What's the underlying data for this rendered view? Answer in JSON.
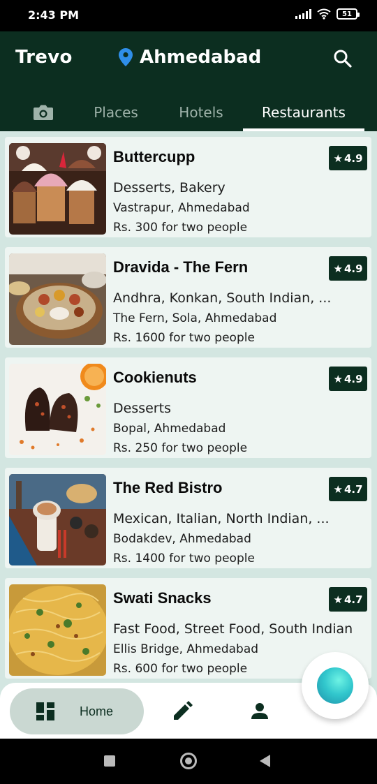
{
  "status_bar": {
    "time": "2:43 PM",
    "battery": "51"
  },
  "header": {
    "brand": "Trevo",
    "location": "Ahmedabad",
    "location_icon": "location-pin-icon",
    "search_icon": "search-icon"
  },
  "tabs": [
    {
      "label": "",
      "icon": "camera-icon"
    },
    {
      "label": "Places"
    },
    {
      "label": "Hotels"
    },
    {
      "label": "Restaurants",
      "active": true
    }
  ],
  "restaurants": [
    {
      "name": "Buttercupp",
      "rating": "4.9",
      "cuisine": "Desserts, Bakery",
      "address": "Vastrapur, Ahmedabad",
      "price": "Rs. 300 for two people"
    },
    {
      "name": "Dravida - The Fern",
      "rating": "4.9",
      "cuisine": "Andhra, Konkan, South Indian, ...",
      "address": "The Fern, Sola, Ahmedabad",
      "price": "Rs. 1600 for two people"
    },
    {
      "name": "Cookienuts",
      "rating": "4.9",
      "cuisine": "Desserts",
      "address": "Bopal, Ahmedabad",
      "price": "Rs. 250 for two people"
    },
    {
      "name": "The Red Bistro",
      "rating": "4.7",
      "cuisine": "Mexican, Italian, North Indian, ...",
      "address": "Bodakdev, Ahmedabad",
      "price": "Rs. 1400 for two people"
    },
    {
      "name": "Swati Snacks",
      "rating": "4.7",
      "cuisine": "Fast Food, Street Food, South Indian",
      "address": "Ellis Bridge, Ahmedabad",
      "price": "Rs. 600 for two people"
    }
  ],
  "bottom_nav": {
    "home_label": "Home",
    "icons": [
      "dashboard-icon",
      "edit-icon",
      "person-icon"
    ]
  },
  "colors": {
    "header_bg": "#0c2e20",
    "page_bg": "#d3e6e1",
    "card_bg": "#eef5f2"
  }
}
